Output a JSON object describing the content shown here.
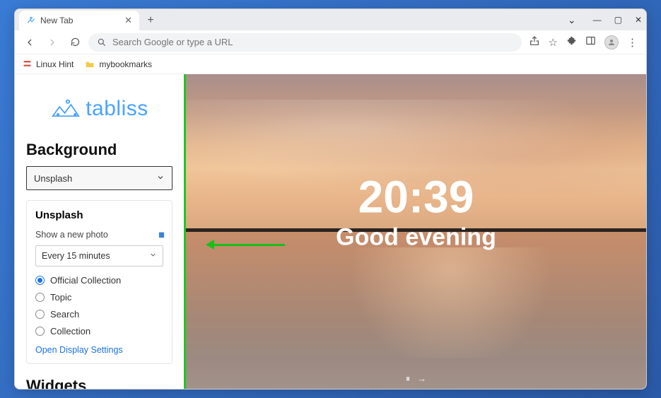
{
  "window": {
    "tab_title": "New Tab",
    "controls": {
      "chevron": "⌄",
      "minimize": "—",
      "maximize": "▢",
      "close": "✕"
    },
    "new_tab_glyph": "+",
    "tab_close_glyph": "✕"
  },
  "toolbar": {
    "omnibox_placeholder": "Search Google or type a URL",
    "share_glyph": "⇪",
    "star_glyph": "☆",
    "ext_glyph": "✦",
    "sidepanel_glyph": "▣",
    "menu_glyph": "⋮"
  },
  "bookmarks": [
    {
      "label": "Linux Hint",
      "favicon_color": "#d04a3a"
    },
    {
      "label": "mybookmarks",
      "favicon_color": "#f7c948"
    }
  ],
  "sidebar": {
    "logo_text": "tabliss",
    "section_background": "Background",
    "background_select_value": "Unsplash",
    "card_title": "Unsplash",
    "show_new_photo_label": "Show a new photo",
    "frequency_value": "Every 15 minutes",
    "radios": [
      {
        "label": "Official Collection",
        "checked": true
      },
      {
        "label": "Topic",
        "checked": false
      },
      {
        "label": "Search",
        "checked": false
      },
      {
        "label": "Collection",
        "checked": false
      }
    ],
    "display_settings_link": "Open Display Settings",
    "section_widgets": "Widgets"
  },
  "preview": {
    "time": "20:39",
    "greeting": "Good evening",
    "footer_pause": "⏸",
    "footer_next": "→"
  }
}
